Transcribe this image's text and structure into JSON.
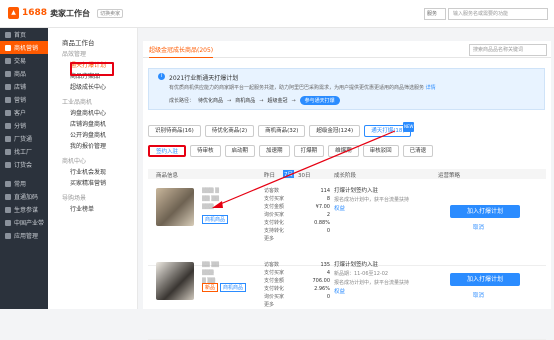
{
  "header": {
    "logo_number": "1688",
    "logo_title": "卖家工作台",
    "logo_tag": "切换卖家",
    "service_label": "服务",
    "search_placeholder": "输入服务名或需要的功能"
  },
  "nav": {
    "items": [
      "首页",
      "商机营销",
      "交易",
      "商品",
      "店铺",
      "营销",
      "客户",
      "分销",
      "厂货通",
      "找工厂",
      "订货会",
      "常用",
      "直通加码",
      "生意参谋",
      "中国产业带",
      "应用管理"
    ],
    "active_index": 1
  },
  "sub": {
    "title": "商品工作台",
    "groups": [
      {
        "heading": "品效管理",
        "items": [
          "通天打爆计划",
          "商品方案品",
          "超级成长中心"
        ]
      },
      {
        "heading": "工业品商机",
        "items": [
          "询盘商机中心",
          "店铺询盘商机",
          "公开询盘商机",
          "我的报价管理"
        ]
      },
      {
        "heading": "商机中心",
        "items": [
          "行业机会发现",
          "买家精准营销"
        ]
      },
      {
        "heading": "导购场景",
        "items": [
          "行业榜单"
        ]
      }
    ],
    "selected": "通天打爆计划"
  },
  "main": {
    "active_tab": "超级金冠成长商品(205)",
    "search_placeholder": "搜索商品品名称关键词",
    "notice_title": "2021行业新通天打爆计划",
    "notice_desc": "有优质商机供应能力的商家期平台一起服务共建，助力阿里巴巴采购需求，为用户提供更优惠更适用的商品筛选服务",
    "notice_link": "详情",
    "path_label": "成长路径：",
    "path_steps": [
      "待优化商品",
      "商机商品",
      "超级金冠"
    ],
    "path_current": "参与通天打爆",
    "filters1": [
      "识别待商品(16)",
      "待优化商品(2)",
      "商机商品(32)",
      "超级金冠(124)",
      "通天打爆(18)"
    ],
    "filters1_badge": "NEW",
    "filters2": [
      "签约入驻",
      "待审核",
      "启动期",
      "加速期",
      "打爆期",
      "维爆期",
      "审核驳回",
      "已清退"
    ],
    "table_headers": [
      "商品信息",
      "昨日",
      "7日",
      "30日",
      "成长阶段",
      "运营策略"
    ],
    "rows": [
      {
        "tag1": "商机商品",
        "stats": "访客数\n支付买家\n支付金额\n询价买家\n支付转化\n支持转化\n更多",
        "vals": "114\n8\n¥7.00\n2\n0.88%\n0\n",
        "plan_title": "打爆计划签约入驻",
        "plan_desc": "报名成功计划中，获平台流量扶持",
        "plan_link": "权益",
        "join": "加入打爆计划",
        "cancel": "取消"
      },
      {
        "tag1": "新品",
        "tag2": "商机商品",
        "stats": "访客数\n支付买家\n支付金额\n支付转化\n询价买家\n更多",
        "vals": "135\n4\n706.00\n2.96%\n0\n",
        "plan_title": "打爆计划签约入驻",
        "plan_desc": "报名成功计划中，获平台流量扶持",
        "plan_sub": "新品期：11-06至12-02",
        "plan_link": "权益",
        "join": "加入打爆计划",
        "cancel": "取消"
      }
    ]
  }
}
